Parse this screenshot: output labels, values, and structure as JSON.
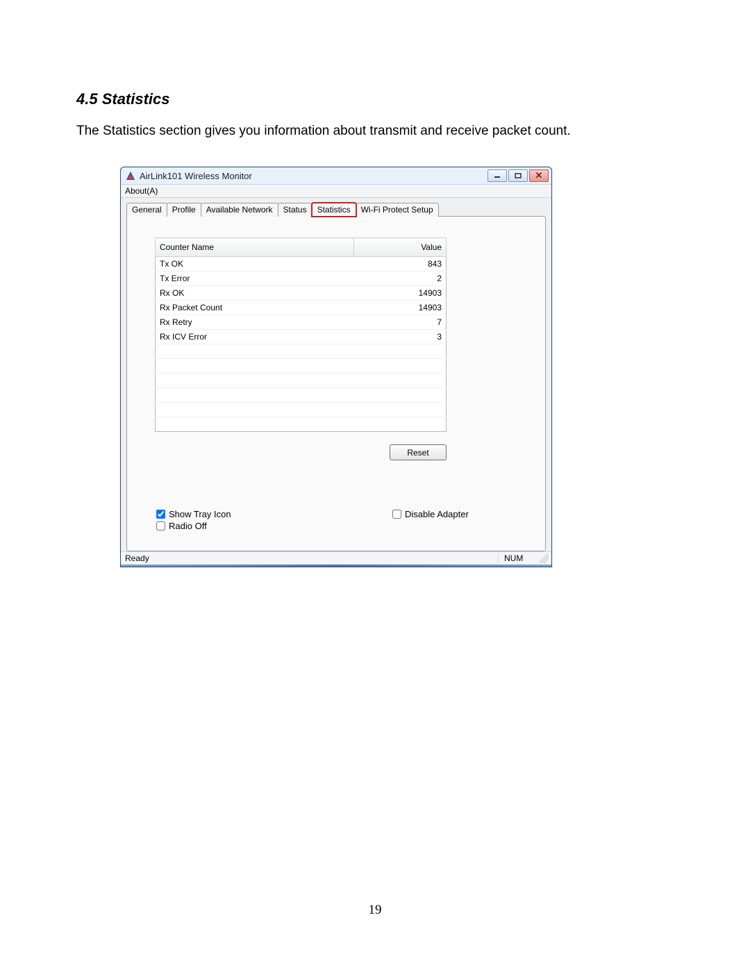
{
  "heading": "4.5 Statistics",
  "body_text": "The Statistics section gives you information about transmit and receive packet count.",
  "page_number": "19",
  "window": {
    "title": "AirLink101 Wireless Monitor",
    "menu": {
      "about": "About(A)"
    },
    "tabs": [
      {
        "label": "General"
      },
      {
        "label": "Profile"
      },
      {
        "label": "Available Network"
      },
      {
        "label": "Status"
      },
      {
        "label": "Statistics"
      },
      {
        "label": "Wi-Fi Protect Setup"
      }
    ],
    "columns": {
      "name": "Counter Name",
      "value": "Value"
    },
    "rows": [
      {
        "name": "Tx OK",
        "value": "843"
      },
      {
        "name": "Tx Error",
        "value": "2"
      },
      {
        "name": "Rx OK",
        "value": "14903"
      },
      {
        "name": "Rx Packet Count",
        "value": "14903"
      },
      {
        "name": "Rx Retry",
        "value": "7"
      },
      {
        "name": "Rx ICV Error",
        "value": "3"
      }
    ],
    "reset_label": "Reset",
    "checkboxes": {
      "show_tray": "Show Tray Icon",
      "disable_adapter": "Disable Adapter",
      "radio_off": "Radio Off"
    },
    "status": {
      "left": "Ready",
      "right": "NUM"
    }
  }
}
